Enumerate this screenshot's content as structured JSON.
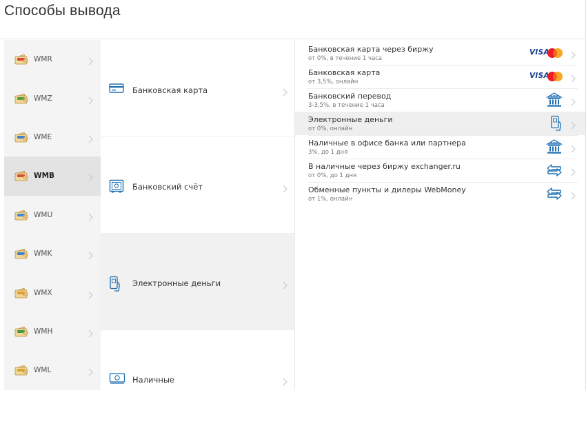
{
  "page": {
    "title": "Способы вывода"
  },
  "currencies": [
    {
      "label": "WMR",
      "icon": "wallet-wmr-icon",
      "color": "#d9473b",
      "active": false
    },
    {
      "label": "WMZ",
      "icon": "wallet-wmz-icon",
      "color": "#5aa03a",
      "active": false
    },
    {
      "label": "WME",
      "icon": "wallet-wme-icon",
      "color": "#3f7fd0",
      "active": false
    },
    {
      "label": "WMB",
      "icon": "wallet-wmb-icon",
      "color": "#d44a3a",
      "active": true
    },
    {
      "label": "WMU",
      "icon": "wallet-wmu-icon",
      "color": "#3f8ad9",
      "active": false
    },
    {
      "label": "WMK",
      "icon": "wallet-wmk-icon",
      "color": "#3c7fd0",
      "active": false
    },
    {
      "label": "WMX",
      "icon": "wallet-wmx-icon",
      "color": "#e59a2c",
      "active": false
    },
    {
      "label": "WMH",
      "icon": "wallet-wmh-icon",
      "color": "#3e9a4a",
      "active": false
    },
    {
      "label": "WML",
      "icon": "wallet-wml-icon",
      "color": "#d4a72c",
      "active": false
    }
  ],
  "methods": [
    {
      "label": "Банковская карта",
      "icon": "bank-card-icon",
      "active": false
    },
    {
      "label": "Банковский счёт",
      "icon": "bank-safe-icon",
      "active": false
    },
    {
      "label": "Электронные деньги",
      "icon": "phone-wallet-icon",
      "active": true
    },
    {
      "label": "Наличные",
      "icon": "cash-icon",
      "active": false
    }
  ],
  "options": [
    {
      "title": "Банковская карта через биржу",
      "sub": "от 0%, в течение 1 часа",
      "icon": "visa-mastercard-icon",
      "visa": "VISA",
      "active": false
    },
    {
      "title": "Банковская карта",
      "sub": "от 3,5%, онлайн",
      "icon": "visa-mastercard-icon",
      "visa": "VISA",
      "active": false
    },
    {
      "title": "Банковский перевод",
      "sub": "3-3,5%, в течение 1 часа",
      "icon": "bank-building-icon",
      "active": false
    },
    {
      "title": "Электронные деньги",
      "sub": "от 0%, онлайн",
      "icon": "phone-wallet-icon",
      "active": true
    },
    {
      "title": "Наличные в офисе банка или партнера",
      "sub": "3%, до 1 дня",
      "icon": "bank-building-icon",
      "active": false
    },
    {
      "title": "В наличные через биржу exchanger.ru",
      "sub": "от 0%, до 1 дня",
      "icon": "exchange-arrows-icon",
      "active": false
    },
    {
      "title": "Обменные пункты и дилеры WebMoney",
      "sub": "от 1%, онлайн",
      "icon": "exchange-arrows-icon",
      "active": false
    }
  ],
  "colors": {
    "accent": "#1f6fb3",
    "visa": "#1a3c8e",
    "mc_red": "#eb1c26",
    "mc_orange": "#f7a21a",
    "active_row": "#e3e3e3"
  },
  "bank_icon_text": "BANK"
}
